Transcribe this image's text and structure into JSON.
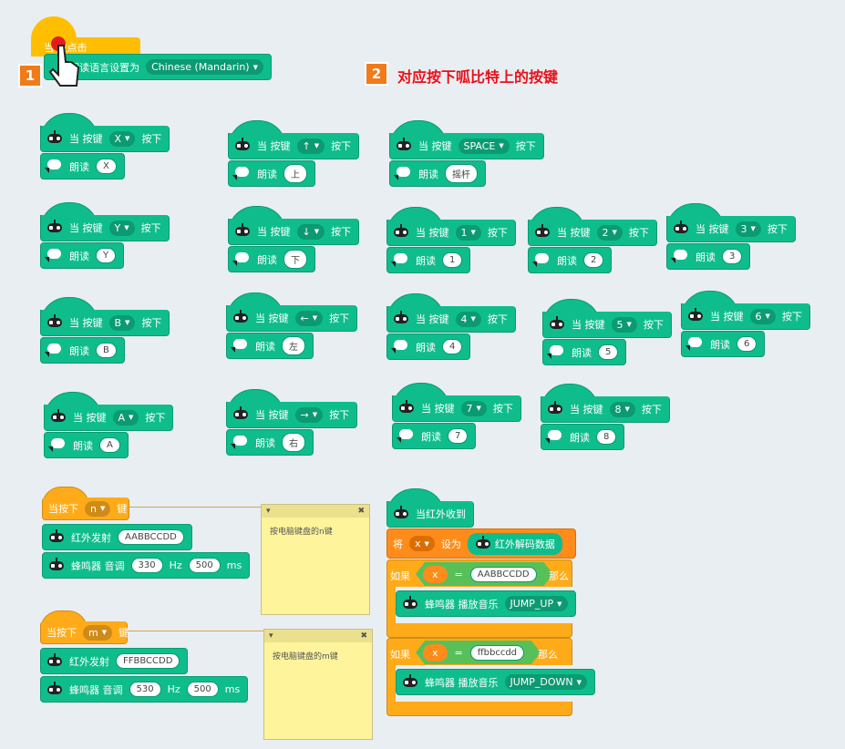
{
  "intro": {
    "hat_label": "当 被点击",
    "set_lang_label": "将朗读语言设置为",
    "language": "Chinese (Mandarin)",
    "step1": "1",
    "step2": "2",
    "heading": "对应按下呱比特上的按键"
  },
  "labels": {
    "when_key": "当 按键",
    "pressed": "按下",
    "speak": "朗读",
    "when_press": "当按下",
    "key": "键",
    "ir_send": "红外发射",
    "buzzer": "蜂鸣器 音调",
    "hz": "Hz",
    "ms": "ms",
    "ir_recv": "当红外收到",
    "set": "将",
    "to": "设为",
    "ir_decode": "红外解码数据",
    "if": "如果",
    "then": "那么",
    "eq": "=",
    "play": "蜂鸣器 播放音乐"
  },
  "key_blocks": [
    {
      "key": "X",
      "say": "X"
    },
    {
      "key": "Y",
      "say": "Y"
    },
    {
      "key": "B",
      "say": "B"
    },
    {
      "key": "A",
      "say": "A"
    },
    {
      "key": "↑",
      "say": "上"
    },
    {
      "key": "↓",
      "say": "下"
    },
    {
      "key": "←",
      "say": "左"
    },
    {
      "key": "→",
      "say": "右"
    },
    {
      "key": "SPACE",
      "say": "摇杆"
    },
    {
      "key": "1",
      "say": "1"
    },
    {
      "key": "4",
      "say": "4"
    },
    {
      "key": "7",
      "say": "7"
    },
    {
      "key": "2",
      "say": "2"
    },
    {
      "key": "5",
      "say": "5"
    },
    {
      "key": "8",
      "say": "8"
    },
    {
      "key": "3",
      "say": "3"
    },
    {
      "key": "6",
      "say": "6"
    }
  ],
  "scripts": [
    {
      "key": "n",
      "ir_code": "AABBCCDD",
      "tone": "330",
      "duration": "500",
      "note": "按电脑键盘的n键"
    },
    {
      "key": "m",
      "ir_code": "FFBBCCDD",
      "tone": "530",
      "duration": "500",
      "note": "按电脑键盘的m键"
    }
  ],
  "ir_script": {
    "var": "x",
    "conditions": [
      {
        "var": "x",
        "value": "AABBCCDD",
        "music": "JUMP_UP"
      },
      {
        "var": "x",
        "value": "ffbbccdd",
        "music": "JUMP_DOWN"
      }
    ]
  },
  "colors": {
    "green": "#0fbd8c",
    "orange": "#ffab19",
    "note": "#fef49c",
    "heading": "#e8101a"
  }
}
